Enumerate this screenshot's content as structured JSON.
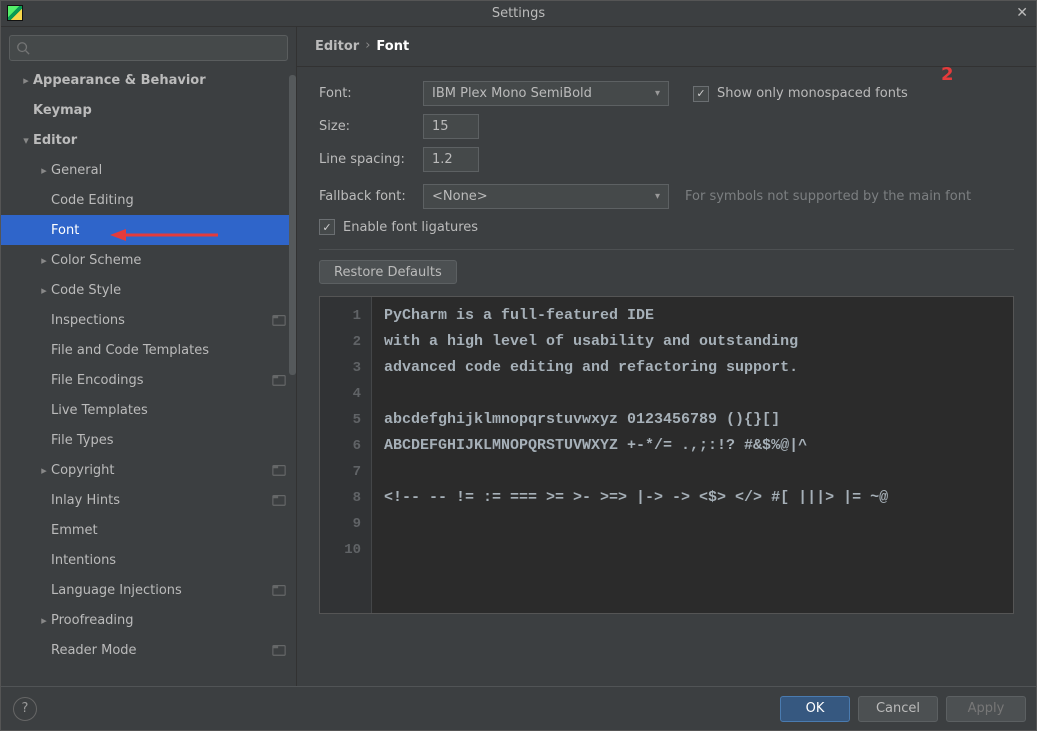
{
  "window": {
    "title": "Settings"
  },
  "breadcrumb": {
    "root": "Editor",
    "leaf": "Font"
  },
  "annotation": {
    "number": "2"
  },
  "sidebar": {
    "items": [
      {
        "label": "Appearance & Behavior",
        "level": 1,
        "chevron": "right",
        "bold": true
      },
      {
        "label": "Keymap",
        "level": 1,
        "chevron": "",
        "bold": true,
        "padExtra": true
      },
      {
        "label": "Editor",
        "level": 1,
        "chevron": "down",
        "bold": true
      },
      {
        "label": "General",
        "level": 2,
        "chevron": "right"
      },
      {
        "label": "Code Editing",
        "level": 2,
        "chevron": "",
        "padExtra": true
      },
      {
        "label": "Font",
        "level": 2,
        "chevron": "",
        "padExtra": true,
        "selected": true
      },
      {
        "label": "Color Scheme",
        "level": 2,
        "chevron": "right"
      },
      {
        "label": "Code Style",
        "level": 2,
        "chevron": "right"
      },
      {
        "label": "Inspections",
        "level": 2,
        "chevron": "",
        "padExtra": true,
        "proj": true
      },
      {
        "label": "File and Code Templates",
        "level": 2,
        "chevron": "",
        "padExtra": true
      },
      {
        "label": "File Encodings",
        "level": 2,
        "chevron": "",
        "padExtra": true,
        "proj": true
      },
      {
        "label": "Live Templates",
        "level": 2,
        "chevron": "",
        "padExtra": true
      },
      {
        "label": "File Types",
        "level": 2,
        "chevron": "",
        "padExtra": true
      },
      {
        "label": "Copyright",
        "level": 2,
        "chevron": "right",
        "proj": true
      },
      {
        "label": "Inlay Hints",
        "level": 2,
        "chevron": "",
        "padExtra": true,
        "proj": true
      },
      {
        "label": "Emmet",
        "level": 2,
        "chevron": "",
        "padExtra": true
      },
      {
        "label": "Intentions",
        "level": 2,
        "chevron": "",
        "padExtra": true
      },
      {
        "label": "Language Injections",
        "level": 2,
        "chevron": "",
        "padExtra": true,
        "proj": true
      },
      {
        "label": "Proofreading",
        "level": 2,
        "chevron": "right"
      },
      {
        "label": "Reader Mode",
        "level": 2,
        "chevron": "",
        "padExtra": true,
        "proj": true
      }
    ]
  },
  "form": {
    "font_label": "Font:",
    "font_value": "IBM Plex Mono SemiBold",
    "show_mono_label": "Show only monospaced fonts",
    "size_label": "Size:",
    "size_value": "15",
    "ls_label": "Line spacing:",
    "ls_value": "1.2",
    "fallback_label": "Fallback font:",
    "fallback_value": "<None>",
    "fallback_hint": "For symbols not supported by the main font",
    "ligatures_label": "Enable font ligatures",
    "restore_label": "Restore Defaults"
  },
  "preview": {
    "lines": [
      "PyCharm is a full-featured IDE",
      "with a high level of usability and outstanding",
      "advanced code editing and refactoring support.",
      "",
      "abcdefghijklmnopqrstuvwxyz 0123456789 (){}[]",
      "ABCDEFGHIJKLMNOPQRSTUVWXYZ +-*/= .,;:!? #&$%@|^",
      "",
      "<!-- -- != := === >= >- >=> |-> -> <$> </> #[ |||> |= ~@",
      "",
      ""
    ]
  },
  "footer": {
    "ok": "OK",
    "cancel": "Cancel",
    "apply": "Apply"
  }
}
